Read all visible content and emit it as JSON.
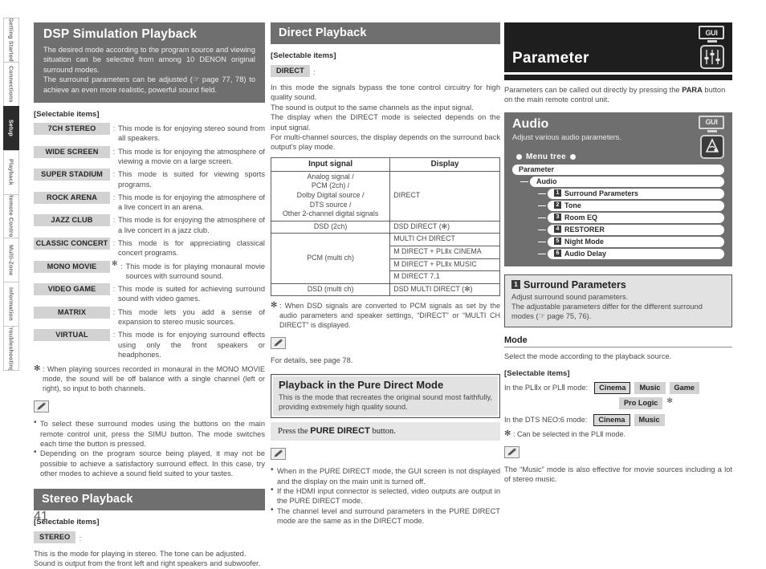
{
  "sidebar": {
    "items": [
      {
        "label": "Getting Started",
        "active": false
      },
      {
        "label": "Connections",
        "active": false
      },
      {
        "label": "Setup",
        "active": true
      },
      {
        "label": "Playback",
        "active": false
      },
      {
        "label": "Remote Control",
        "active": false
      },
      {
        "label": "Multi-Zone",
        "active": false
      },
      {
        "label": "Information",
        "active": false
      },
      {
        "label": "Troubleshooting",
        "active": false
      }
    ]
  },
  "page_number": "41",
  "left": {
    "hero_title": "DSP Simulation Playback",
    "hero_text": "The desired mode according to the program source and viewing situation can be selected from among 10 DENON original surround modes.\nThe surround parameters can be adjusted (☞ page 77, 78) to achieve an even more realistic, powerful sound field.",
    "selectable_label": "[Selectable items]",
    "modes": [
      {
        "name": "7CH STEREO",
        "desc": "This mode is for enjoying stereo sound from all speakers.",
        "asterisk": false
      },
      {
        "name": "WIDE SCREEN",
        "desc": "This mode is for enjoying the atmosphere of viewing a movie on a large screen.",
        "asterisk": false
      },
      {
        "name": "SUPER STADIUM",
        "desc": "This mode is suited for viewing sports programs.",
        "asterisk": false
      },
      {
        "name": "ROCK ARENA",
        "desc": "This mode is for enjoying the atmosphere of a live concert in an arena.",
        "asterisk": false
      },
      {
        "name": "JAZZ CLUB",
        "desc": "This mode is for enjoying the atmosphere of a live concert in a jazz club.",
        "asterisk": false
      },
      {
        "name": "CLASSIC CONCERT",
        "desc": "This mode is for appreciating classical concert programs.",
        "asterisk": false
      },
      {
        "name": "MONO MOVIE",
        "desc": "This mode is for playing monaural movie sources with surround sound.",
        "asterisk": true
      },
      {
        "name": "VIDEO GAME",
        "desc": "This mode is suited for achieving surround sound with video games.",
        "asterisk": false
      },
      {
        "name": "MATRIX",
        "desc": "This mode lets you add a sense of expansion to stereo music sources.",
        "asterisk": false
      },
      {
        "name": "VIRTUAL",
        "desc": "This mode is for enjoying surround effects using only the front speakers or headphones.",
        "asterisk": false
      }
    ],
    "footnote_mark": "✻",
    "footnote": ": When playing sources recorded in monaural in the MONO MOVIE mode, the sound will be off balance with a single channel (left or right), so input to both channels.",
    "notes": [
      "To select these surround modes using the buttons on the main remote control unit, press the SIMU button. The mode switches each time the button is pressed.",
      "Depending on the program source being played, it may not be possible to achieve a satisfactory surround effect. In this case, try other modes to achieve a sound field suited to your tastes."
    ],
    "stereo_header": "Stereo Playback",
    "stereo_selectable_label": "[Selectable items]",
    "stereo_chip": "STEREO",
    "stereo_text": "This is the mode for playing in stereo. The tone can be adjusted.\nSound is output from the front left and right speakers and subwoofer."
  },
  "mid": {
    "header": "Direct Playback",
    "selectable_label": "[Selectable items]",
    "direct_chip": "DIRECT",
    "intro": "In this mode the signals bypass the tone control circuitry for high quality sound.\nThe sound is output to the same channels as the input signal.\nThe display when the DIRECT mode is selected depends on the input signal.\nFor multi-channel sources, the display depends on the surround back output's play mode.",
    "table": {
      "headers": [
        "Input signal",
        "Display"
      ],
      "rows": [
        {
          "input": "Analog signal /\nPCM (2ch) /\nDolby Digital source /\nDTS source /\nOther 2-channel digital signals",
          "displays": [
            "DIRECT"
          ]
        },
        {
          "input": "DSD (2ch)",
          "displays": [
            "DSD DIRECT (✻)"
          ]
        },
        {
          "input": "PCM (multi ch)",
          "displays": [
            "MULTI CH DIRECT",
            "M DIRECT + PLⅡx CINEMA",
            "M DIRECT + PLⅡx MUSIC",
            "M DIRECT 7.1"
          ]
        },
        {
          "input": "DSD (multi ch)",
          "displays": [
            "DSD MULTI DIRECT (✻)"
          ]
        }
      ]
    },
    "footnote_mark": "✻",
    "footnote": ": When DSD signals are converted to PCM signals as set by the audio parameters and speaker settings, “DIRECT” or “MULTI CH DIRECT” is displayed.",
    "details_note": "For details, see page 78.",
    "pure_title": "Playback in the Pure Direct Mode",
    "pure_text": "This is the mode that recreates the original sound most faithfully, providing extremely high quality sound.",
    "press_pre": "Press the ",
    "press_bold": "PURE DIRECT",
    "press_post": " button.",
    "pure_notes": [
      "When in the PURE DIRECT mode, the GUI screen is not displayed and the display on the main unit is turned off.",
      "If the HDMI input connector is selected, video outputs are output in the PURE DIRECT mode.",
      "The channel level and surround parameters in the PURE DIRECT mode are the same as in the DIRECT mode."
    ]
  },
  "right": {
    "gui_badge": "GUI",
    "parameter_title": "Parameter",
    "parameter_intro_pre": "Parameters can be called out directly by pressing the ",
    "parameter_intro_bold": "PARA",
    "parameter_intro_post": " button on the main remote control unit.",
    "audio_title": "Audio",
    "audio_sub": "Adjust various audio parameters.",
    "menu_tree_label": "Menu tree",
    "tree_root": "Parameter",
    "tree_child": "Audio",
    "tree_items": [
      {
        "num": "1",
        "label": "Surround Parameters"
      },
      {
        "num": "2",
        "label": "Tone"
      },
      {
        "num": "3",
        "label": "Room EQ"
      },
      {
        "num": "4",
        "label": "RESTORER"
      },
      {
        "num": "5",
        "label": "Night Mode"
      },
      {
        "num": "6",
        "label": "Audio Delay"
      }
    ],
    "sp_num": "1",
    "sp_title": "Surround Parameters",
    "sp_text": "Adjust surround sound parameters.\nThe adjustable parameters differ for the different surround modes (☞ page 75, 76).",
    "mode_head": "Mode",
    "mode_desc": "Select the mode according to the playback source.",
    "selectable_label": "[Selectable items]",
    "plx_label": "In the PLⅡx or PLⅡ mode:",
    "plx_buttons": [
      "Cinema",
      "Music",
      "Game"
    ],
    "plx_buttons2": [
      "Pro Logic"
    ],
    "plx_selected": "Cinema",
    "dts_label": "In the DTS NEO:6 mode:",
    "dts_buttons": [
      "Cinema",
      "Music"
    ],
    "dts_selected": "Cinema",
    "footnote_mark": "✻",
    "footnote": ": Can be selected in the PLⅡ mode.",
    "final_note": "The “Music” mode is also effective for movie sources including a lot of stereo music."
  }
}
